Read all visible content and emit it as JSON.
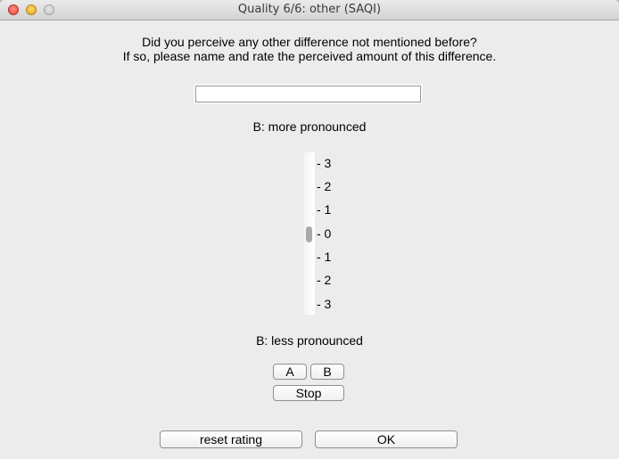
{
  "window": {
    "title": "Quality 6/6: other (SAQI)"
  },
  "question": {
    "line1": "Did you perceive any other difference not mentioned before?",
    "line2": "If so, please name and rate the perceived amount of this difference."
  },
  "difference_input": {
    "value": "",
    "placeholder": ""
  },
  "scale": {
    "top_label": "B: more pronounced",
    "bottom_label": "B: less pronounced",
    "ticks": [
      "- 3",
      "- 2",
      "- 1",
      "- 0",
      "- 1",
      "- 2",
      "- 3"
    ],
    "current_value": 0
  },
  "playback": {
    "a_label": "A",
    "b_label": "B",
    "stop_label": "Stop"
  },
  "footer": {
    "reset_label": "reset rating",
    "ok_label": "OK"
  }
}
